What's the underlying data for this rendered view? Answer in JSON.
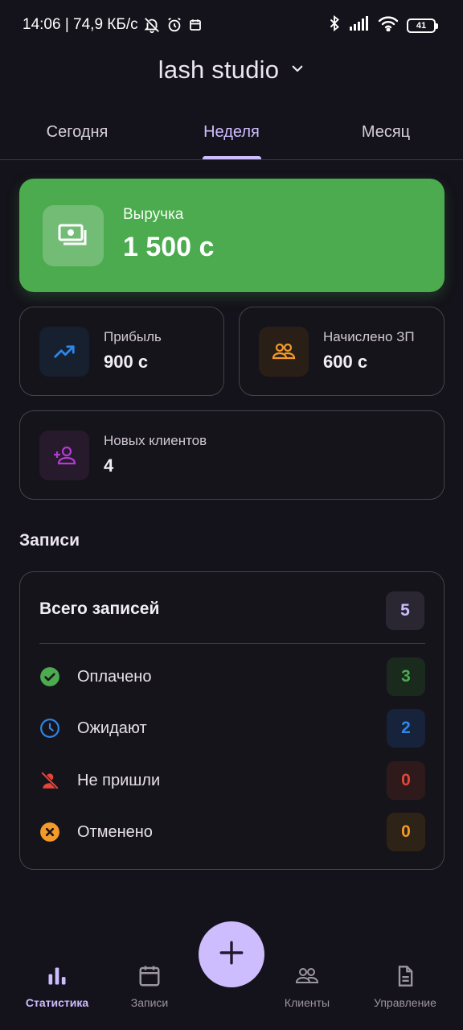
{
  "status_bar": {
    "time_speed": "14:06 | 74,9 КБ/с",
    "battery": "41",
    "icons": [
      "bell-off-icon",
      "alarm-icon",
      "calendar-icon",
      "bluetooth-icon",
      "signal-icon",
      "wifi-icon",
      "battery-icon"
    ]
  },
  "header": {
    "studio_name": "lash studio",
    "dropdown_icon": "chevron-down-icon"
  },
  "tabs": [
    {
      "label": "Сегодня",
      "active": false
    },
    {
      "label": "Неделя",
      "active": true
    },
    {
      "label": "Месяц",
      "active": false
    }
  ],
  "revenue": {
    "label": "Выручка",
    "value": "1 500 с",
    "icon": "cash-icon",
    "color": "#4caa4f"
  },
  "stats": {
    "profit": {
      "label": "Прибыль",
      "value": "900 с",
      "icon": "trending-up-icon",
      "color": "#2f86e8"
    },
    "salary": {
      "label": "Начислено ЗП",
      "value": "600 с",
      "icon": "group-icon",
      "color": "#f39a2a"
    },
    "new_clients": {
      "label": "Новых клиентов",
      "value": "4",
      "icon": "person-add-icon",
      "color": "#b23bd0"
    }
  },
  "records": {
    "section_title": "Записи",
    "total_label": "Всего записей",
    "total_count": "5",
    "rows": [
      {
        "label": "Оплачено",
        "count": "3",
        "icon": "check-circle-icon",
        "color": "#4caa4f"
      },
      {
        "label": "Ожидают",
        "count": "2",
        "icon": "clock-icon",
        "color": "#2f86e8"
      },
      {
        "label": "Не пришли",
        "count": "0",
        "icon": "person-off-icon",
        "color": "#e5453a"
      },
      {
        "label": "Отменено",
        "count": "0",
        "icon": "cancel-circle-icon",
        "color": "#f39a2a"
      }
    ]
  },
  "fab": {
    "icon": "plus-icon"
  },
  "bottom_nav": [
    {
      "label": "Статистика",
      "icon": "bar-chart-icon",
      "active": true
    },
    {
      "label": "Записи",
      "icon": "calendar-icon",
      "active": false
    },
    {
      "label": "Клиенты",
      "icon": "group-icon",
      "active": false
    },
    {
      "label": "Управление",
      "icon": "document-icon",
      "active": false
    }
  ]
}
